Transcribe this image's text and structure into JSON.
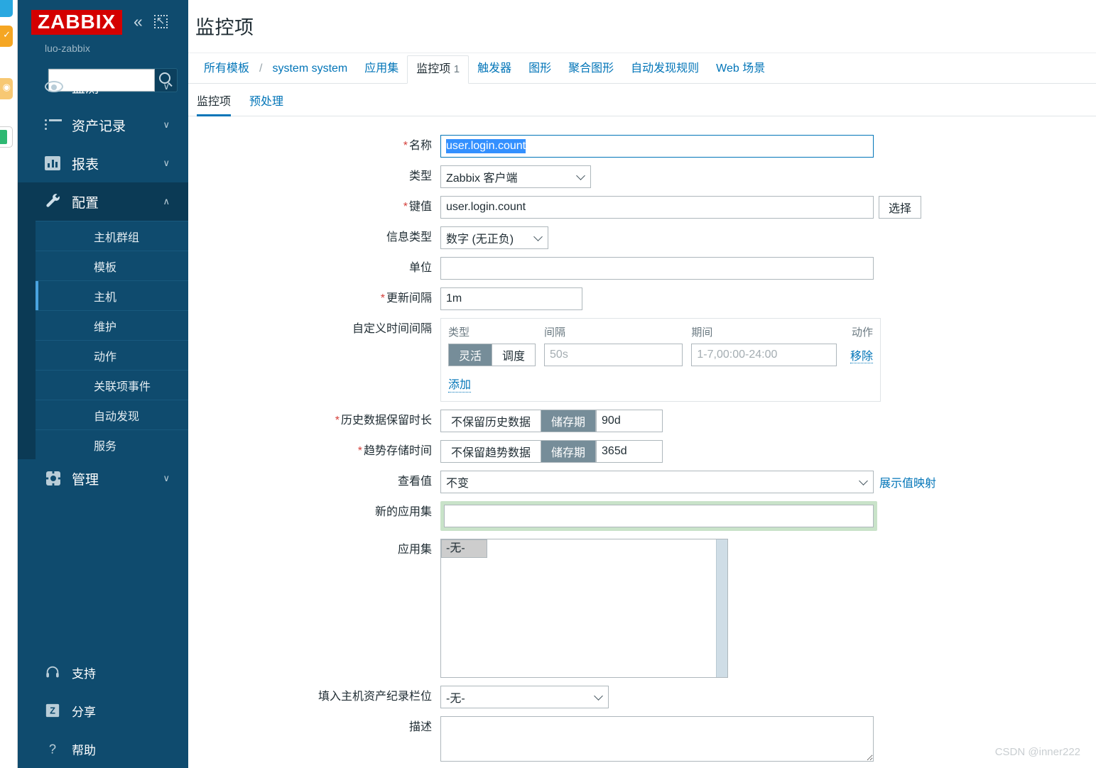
{
  "browser": {
    "extension_icons": [
      "extension-blue-icon",
      "extension-orange-icon",
      "extension-rss-icon",
      "extension-green-icon"
    ]
  },
  "sidebar": {
    "logo": "ZABBIX",
    "server_name": "luo-zabbix",
    "collapse_icon": "double-chevron-left-icon",
    "compact_icon": "compact-view-icon",
    "search": {
      "value": "",
      "placeholder": "",
      "icon": "search-icon"
    },
    "nav": [
      {
        "label": "监测",
        "icon": "eye-icon",
        "caret": "∨",
        "active": false
      },
      {
        "label": "资产记录",
        "icon": "list-icon",
        "caret": "∨",
        "active": false
      },
      {
        "label": "报表",
        "icon": "chart-icon",
        "caret": "∨",
        "active": false
      },
      {
        "label": "配置",
        "icon": "wrench-icon",
        "caret": "∧",
        "active": true
      }
    ],
    "sub_items": [
      {
        "label": "主机群组",
        "selected": false
      },
      {
        "label": "模板",
        "selected": false
      },
      {
        "label": "主机",
        "selected": true
      },
      {
        "label": "维护",
        "selected": false
      },
      {
        "label": "动作",
        "selected": false
      },
      {
        "label": "关联项事件",
        "selected": false
      },
      {
        "label": "自动发现",
        "selected": false
      },
      {
        "label": "服务",
        "selected": false
      }
    ],
    "admin": {
      "label": "管理",
      "icon": "gear-icon",
      "caret": "∨"
    },
    "bottom": [
      {
        "label": "支持",
        "icon": "headset-icon"
      },
      {
        "label": "分享",
        "icon": "zabbix-z-icon"
      },
      {
        "label": "帮助",
        "icon": "question-icon"
      }
    ]
  },
  "header": {
    "title": "监控项"
  },
  "breadcrumb": [
    {
      "label": "所有模板",
      "type": "link"
    },
    {
      "label": "/",
      "type": "sep"
    },
    {
      "label": "system system",
      "type": "link"
    },
    {
      "label": "应用集",
      "type": "link"
    },
    {
      "label": "监控项",
      "count": "1",
      "type": "current"
    },
    {
      "label": "触发器",
      "type": "link"
    },
    {
      "label": "图形",
      "type": "link"
    },
    {
      "label": "聚合图形",
      "type": "link"
    },
    {
      "label": "自动发现规则",
      "type": "link"
    },
    {
      "label": "Web 场景",
      "type": "link"
    }
  ],
  "tabs": [
    {
      "label": "监控项",
      "active": true
    },
    {
      "label": "预处理",
      "active": false
    }
  ],
  "form": {
    "name": {
      "label": "名称",
      "required": true,
      "value": "user.login.count",
      "selected": true
    },
    "type": {
      "label": "类型",
      "required": false,
      "value": "Zabbix 客户端"
    },
    "key": {
      "label": "键值",
      "required": true,
      "value": "user.login.count",
      "button": "选择"
    },
    "info_type": {
      "label": "信息类型",
      "required": false,
      "value": "数字 (无正负)"
    },
    "units": {
      "label": "单位",
      "required": false,
      "value": "",
      "placeholder": ""
    },
    "update_interval": {
      "label": "更新间隔",
      "required": true,
      "value": "1m"
    },
    "custom_intervals": {
      "label": "自定义时间间隔",
      "required": false,
      "headers": [
        "类型",
        "间隔",
        "期间",
        "动作"
      ],
      "rows": [
        {
          "type_options": [
            "灵活",
            "调度"
          ],
          "type_selected": "灵活",
          "interval_value": "",
          "interval_placeholder": "50s",
          "period_value": "",
          "period_placeholder": "1-7,00:00-24:00",
          "action_label": "移除"
        }
      ],
      "add_label": "添加"
    },
    "history": {
      "label": "历史数据保留时长",
      "required": true,
      "options": [
        "不保留历史数据",
        "储存期"
      ],
      "selected": "储存期",
      "value": "90d"
    },
    "trends": {
      "label": "趋势存储时间",
      "required": true,
      "options": [
        "不保留趋势数据",
        "储存期"
      ],
      "selected": "储存期",
      "value": "365d"
    },
    "value_view": {
      "label": "查看值",
      "required": false,
      "value": "不变",
      "link": "展示值映射"
    },
    "new_application": {
      "label": "新的应用集",
      "required": false,
      "value": "",
      "placeholder": "",
      "highlight_color": "#c9e3c9"
    },
    "applications": {
      "label": "应用集",
      "required": false,
      "options": [
        "-无-"
      ],
      "selected": "-无-"
    },
    "inventory_field": {
      "label": "填入主机资产纪录栏位",
      "required": false,
      "value": "-无-"
    },
    "description": {
      "label": "描述",
      "required": false,
      "value": "",
      "placeholder": ""
    }
  },
  "watermark": "CSDN @inner222",
  "colors": {
    "sidebar_bg": "#0f4b6e",
    "sidebar_active": "#0b3a55",
    "logo_red": "#d40000",
    "link_blue": "#0275b8",
    "selection_blue": "#3390ff",
    "toggle_on": "#768d99",
    "green_highlight": "#c9e3c9",
    "required_red": "#d43f3a"
  }
}
